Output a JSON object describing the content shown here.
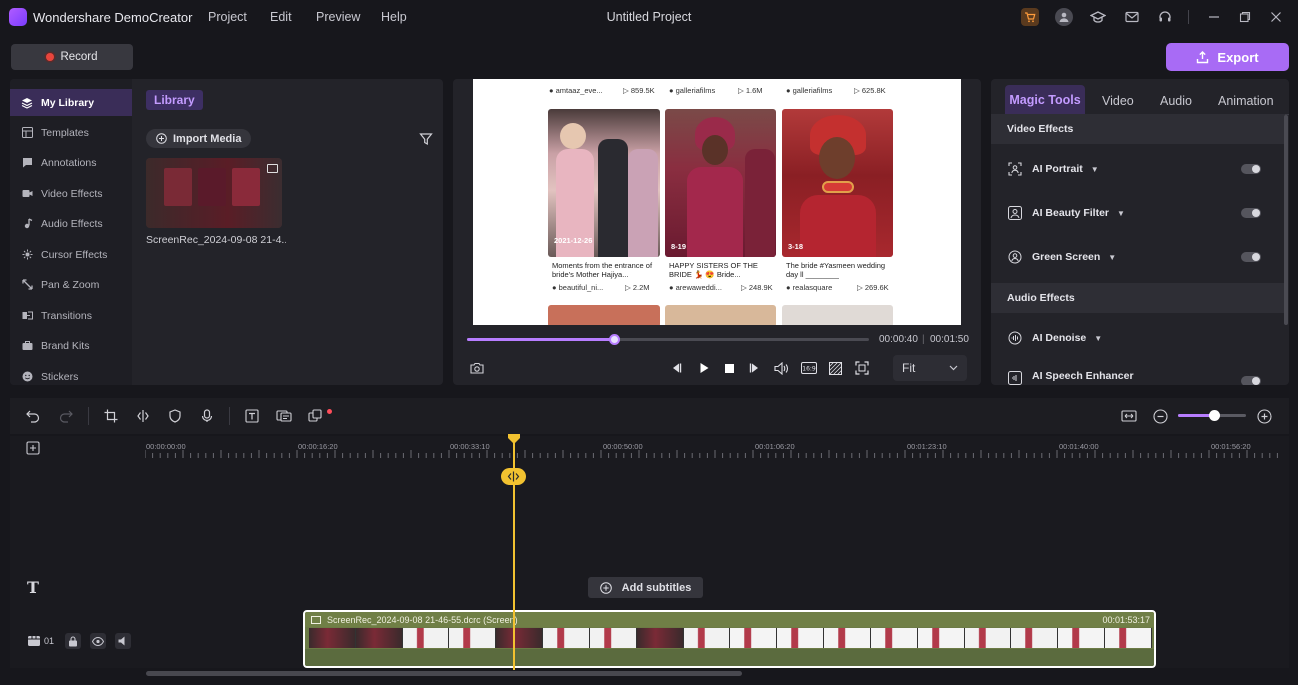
{
  "app": {
    "name": "Wondershare DemoCreator",
    "project_title": "Untitled Project",
    "menu": [
      "Project",
      "Edit",
      "Preview",
      "Help"
    ],
    "title_icons": [
      "cart-icon",
      "account-icon",
      "graduation-cap-icon",
      "mail-icon",
      "headset-icon",
      "minimize-icon",
      "restore-icon",
      "close-icon"
    ],
    "accent_color": "#a86bf5"
  },
  "toolbar": {
    "record_label": "Record",
    "export_label": "Export"
  },
  "sidebar": {
    "items": [
      {
        "label": "My Library",
        "icon": "library-icon",
        "active": true
      },
      {
        "label": "Templates",
        "icon": "templates-icon",
        "active": false
      },
      {
        "label": "Annotations",
        "icon": "annotations-icon",
        "active": false
      },
      {
        "label": "Video Effects",
        "icon": "video-effects-icon",
        "active": false
      },
      {
        "label": "Audio Effects",
        "icon": "audio-effects-icon",
        "active": false
      },
      {
        "label": "Cursor Effects",
        "icon": "cursor-icon",
        "active": false
      },
      {
        "label": "Pan & Zoom",
        "icon": "pan-zoom-icon",
        "active": false
      },
      {
        "label": "Transitions",
        "icon": "transitions-icon",
        "active": false
      },
      {
        "label": "Brand Kits",
        "icon": "brand-kits-icon",
        "active": false
      },
      {
        "label": "Stickers",
        "icon": "stickers-icon",
        "active": false
      }
    ]
  },
  "library": {
    "tag": "Library",
    "import_label": "Import Media",
    "media": [
      {
        "name": "ScreenRec_2024-09-08 21-4..."
      }
    ]
  },
  "preview": {
    "canvas": {
      "top_row": [
        {
          "user": "amtaaz_eve...",
          "views": "859.5K"
        },
        {
          "user": "galleriafilms",
          "views": "1.6M"
        },
        {
          "user": "galleriafilms",
          "views": "625.8K"
        }
      ],
      "posts": [
        {
          "date": "2021-12-26",
          "caption": "Moments from the entrance of bride's Mother Hajiya...",
          "user": "beautiful_ni...",
          "views": "2.2M"
        },
        {
          "date": "8-19",
          "caption": "HAPPY SISTERS OF THE BRIDE 💃 😍 Bride...",
          "user": "arewaweddi...",
          "views": "248.9K"
        },
        {
          "date": "3-18",
          "caption": "The bride #Yasmeen wedding day ll ________",
          "user": "realasquare",
          "views": "269.6K"
        }
      ]
    },
    "current_time": "00:00:40",
    "total_time": "00:01:50",
    "progress": 0.365,
    "fit_label": "Fit"
  },
  "right_panel": {
    "tabs": [
      "Magic Tools",
      "Video",
      "Audio",
      "Animation"
    ],
    "active_tab": "Magic Tools",
    "sections": [
      {
        "title": "Video Effects",
        "items": [
          {
            "label": "AI Portrait",
            "icon": "portrait-icon",
            "enabled": false
          },
          {
            "label": "AI Beauty Filter",
            "icon": "beauty-icon",
            "enabled": false
          },
          {
            "label": "Green Screen",
            "icon": "green-screen-icon",
            "enabled": false
          }
        ]
      },
      {
        "title": "Audio Effects",
        "items": [
          {
            "label": "AI Denoise",
            "icon": "denoise-icon",
            "enabled": false
          },
          {
            "label": "AI Speech Enhancer",
            "icon": "speech-icon",
            "enabled": false
          }
        ]
      }
    ]
  },
  "timeline": {
    "ruler_labels": [
      "00:00:00:00",
      "00:00:16:20",
      "00:00:33:10",
      "00:00:50:00",
      "00:01:06:20",
      "00:01:23:10",
      "00:01:40:00",
      "00:01:56:20"
    ],
    "subtitle_label": "Add subtitles",
    "track_number": "01",
    "zoom": 0.53,
    "clip": {
      "name": "ScreenRec_2024-09-08 21-46-55.dcrc (Screen)",
      "duration": "00:01:53:17",
      "color": "#6b7a45"
    }
  }
}
